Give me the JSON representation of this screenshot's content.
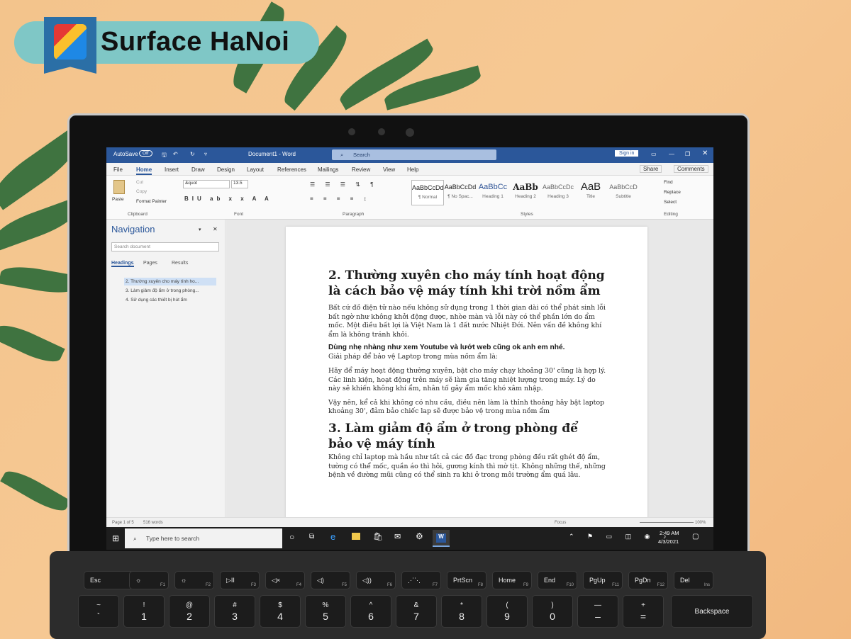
{
  "brand": {
    "text": "Surface HaNoi"
  },
  "word": {
    "titlebar": {
      "autosave": "AutoSave",
      "toggle": "Off",
      "doc_title": "Document1 - Word",
      "search": "Search",
      "signin": "Sign in"
    },
    "menus": [
      "File",
      "Home",
      "Insert",
      "Draw",
      "Design",
      "Layout",
      "References",
      "Mailings",
      "Review",
      "View",
      "Help"
    ],
    "share": "Share",
    "comments": "Comments",
    "clipboard": {
      "paste": "Paste",
      "cut": "Cut",
      "copy": "Copy",
      "format_painter": "Format Painter",
      "label": "Clipboard"
    },
    "font": {
      "name": "&quot",
      "size": "13.5",
      "label": "Font"
    },
    "paragraph_label": "Paragraph",
    "styles": [
      {
        "preview": "AaBbCcDd",
        "name": "¶ Normal"
      },
      {
        "preview": "AaBbCcDd",
        "name": "¶ No Spac..."
      },
      {
        "preview": "AaBbCc",
        "name": "Heading 1"
      },
      {
        "preview": "AaBb",
        "name": "Heading 2"
      },
      {
        "preview": "AaBbCcDc",
        "name": "Heading 3"
      },
      {
        "preview": "AaB",
        "name": "Title"
      },
      {
        "preview": "AaBbCcD",
        "name": "Subtitle"
      }
    ],
    "styles_label": "Styles",
    "editing": {
      "find": "Find",
      "replace": "Replace",
      "select": "Select",
      "label": "Editing"
    },
    "nav": {
      "title": "Navigation",
      "search_placeholder": "Search document",
      "tabs": [
        "Headings",
        "Pages",
        "Results"
      ],
      "items": [
        "2. Thường xuyên cho máy tính ho...",
        "3. Làm giảm độ ẩm ở trong phòng...",
        "4. Sử dụng các thiết bị hút ẩm"
      ]
    },
    "doc": {
      "h1": "2. Thường xuyên cho máy tính hoạt động là cách bảo vệ máy tính khi trời nồm ẩm",
      "p1": "Bất cứ đồ điện tử nào nếu không sử dụng trong 1 thời gian dài có thể phát sinh lỗi bất ngờ như không khởi động được, nhòe màn và lỗi này có thể phần lớn do ẩm mốc. Một điều bất lợi là Việt Nam là 1 đất nước Nhiệt Đới. Nên vấn đề không khí ẩm là không tránh khỏi.",
      "bold": "Dùng nhẹ nhàng như xem Youtube và lướt web cũng ok anh em nhé.",
      "p2": "Giải pháp để bảo vệ Laptop trong mùa nồm ẩm là:",
      "p3": "Hãy để máy hoạt động thường xuyên, bật cho máy chạy khoảng 30' cũng là hợp lý. Các linh kiện, hoạt động trên máy sẽ làm gia tăng nhiệt lượng trong máy. Lý do này sẽ khiến không khí ẩm, nhân tố gây ẩm mốc khó xâm nhập.",
      "p4": "Vậy nên, kể cả khi không có nhu cầu, điều nên làm là thỉnh thoảng hãy bật laptop khoảng 30', đảm bảo chiếc lap sẽ được bảo vệ trong mùa nồm ẩm",
      "h2": "3. Làm giảm độ ẩm ở trong phòng để bảo vệ máy tính",
      "p5": "Không chỉ laptop mà hầu như tất cả các đồ đạc trong phòng đều rất ghét độ ẩm, tường có thể mốc, quần áo thì hôi, gương kính thì mờ tịt. Không những thế, những bệnh về đường mũi cũng có thể sinh ra khi ở trong môi trường ẩm quá lâu."
    },
    "status": {
      "page": "Page 1 of 5",
      "words": "516 words",
      "focus": "Focus",
      "zoom": "100%"
    }
  },
  "taskbar": {
    "search": "Type here to search",
    "time": "2:49 AM",
    "date": "4/3/2021"
  },
  "keys": [
    {
      "top": "Esc",
      "sub": ""
    },
    {
      "top": "☼",
      "sub": "F1"
    },
    {
      "top": "☼",
      "sub": "F2"
    },
    {
      "top": "▷II",
      "sub": "F3"
    },
    {
      "top": "◁×",
      "sub": "F4"
    },
    {
      "top": "◁)",
      "sub": "F5"
    },
    {
      "top": "◁))",
      "sub": "F6"
    },
    {
      "top": "⋰⋱",
      "sub": "F7"
    },
    {
      "top": "PrtScn",
      "sub": "F8"
    },
    {
      "top": "Home",
      "sub": "F9"
    },
    {
      "top": "End",
      "sub": "F10"
    },
    {
      "top": "PgUp",
      "sub": "F11"
    },
    {
      "top": "PgDn",
      "sub": "F12"
    },
    {
      "top": "Del",
      "sub": "Ins"
    }
  ],
  "number_keys": [
    {
      "t": "~",
      "b": "`"
    },
    {
      "t": "!",
      "b": "1"
    },
    {
      "t": "@",
      "b": "2"
    },
    {
      "t": "#",
      "b": "3"
    },
    {
      "t": "$",
      "b": "4"
    },
    {
      "t": "%",
      "b": "5"
    },
    {
      "t": "^",
      "b": "6"
    },
    {
      "t": "&",
      "b": "7"
    },
    {
      "t": "*",
      "b": "8"
    },
    {
      "t": "(",
      "b": "9"
    },
    {
      "t": ")",
      "b": "0"
    },
    {
      "t": "—",
      "b": "–"
    },
    {
      "t": "+",
      "b": "="
    }
  ],
  "backspace": "Backspace"
}
